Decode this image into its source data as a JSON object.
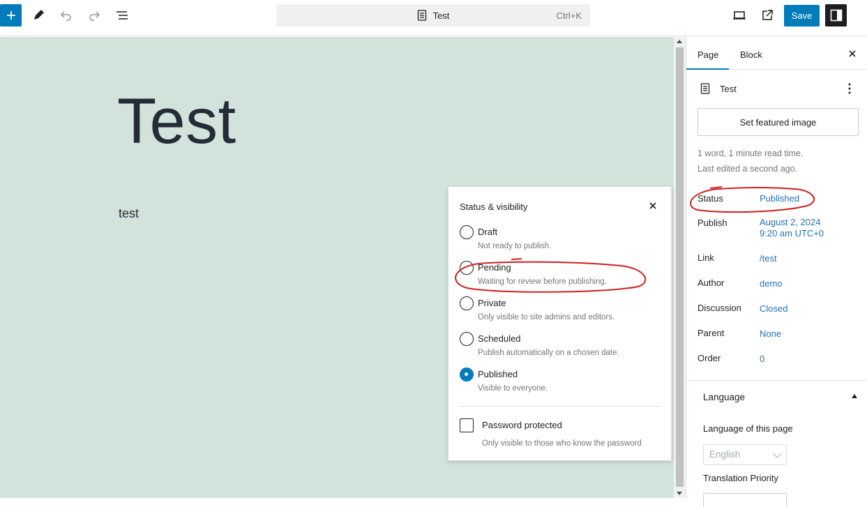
{
  "topbar": {
    "document_title": "Test",
    "shortcut": "Ctrl+K",
    "save_label": "Save",
    "accent_color": "#007cba"
  },
  "canvas": {
    "title": "Test",
    "body": "test",
    "background": "#d2e3dc"
  },
  "status_popover": {
    "title": "Status & visibility",
    "options": [
      {
        "label": "Draft",
        "description": "Not ready to publish.",
        "checked": false
      },
      {
        "label": "Pending",
        "description": "Waiting for review before publishing.",
        "checked": false
      },
      {
        "label": "Private",
        "description": "Only visible to site admins and editors.",
        "checked": false
      },
      {
        "label": "Scheduled",
        "description": "Publish automatically on a chosen date.",
        "checked": false
      },
      {
        "label": "Published",
        "description": "Visible to everyone.",
        "checked": true
      }
    ],
    "password": {
      "label": "Password protected",
      "description": "Only visible to those who know the password",
      "checked": false
    }
  },
  "sidebar": {
    "tabs": [
      "Page",
      "Block"
    ],
    "active_tab": "Page",
    "doc_title": "Test",
    "featured_image_label": "Set featured image",
    "meta_line1": "1 word, 1 minute read time.",
    "meta_line2": "Last edited a second ago.",
    "rows": [
      {
        "label": "Status",
        "value": "Published"
      },
      {
        "label": "Publish",
        "value": "August 2, 2024",
        "value2": "9:20 am UTC+0"
      },
      {
        "label": "Link",
        "value": "/test"
      },
      {
        "label": "Author",
        "value": "demo"
      },
      {
        "label": "Discussion",
        "value": "Closed"
      },
      {
        "label": "Parent",
        "value": "None"
      },
      {
        "label": "Order",
        "value": "0"
      }
    ],
    "language": {
      "section_title": "Language",
      "label": "Language of this page",
      "selected": "English",
      "priority_label": "Translation Priority"
    }
  },
  "icons": [
    "plus-icon",
    "pencil-icon",
    "undo-icon",
    "redo-icon",
    "list-view-icon",
    "document-icon",
    "desktop-preview-icon",
    "external-link-icon",
    "sidebar-toggle-icon",
    "close-icon",
    "kebab-menu-icon",
    "chevron-up-icon",
    "chevron-down-icon"
  ],
  "annotation_color": "#d01f1f"
}
